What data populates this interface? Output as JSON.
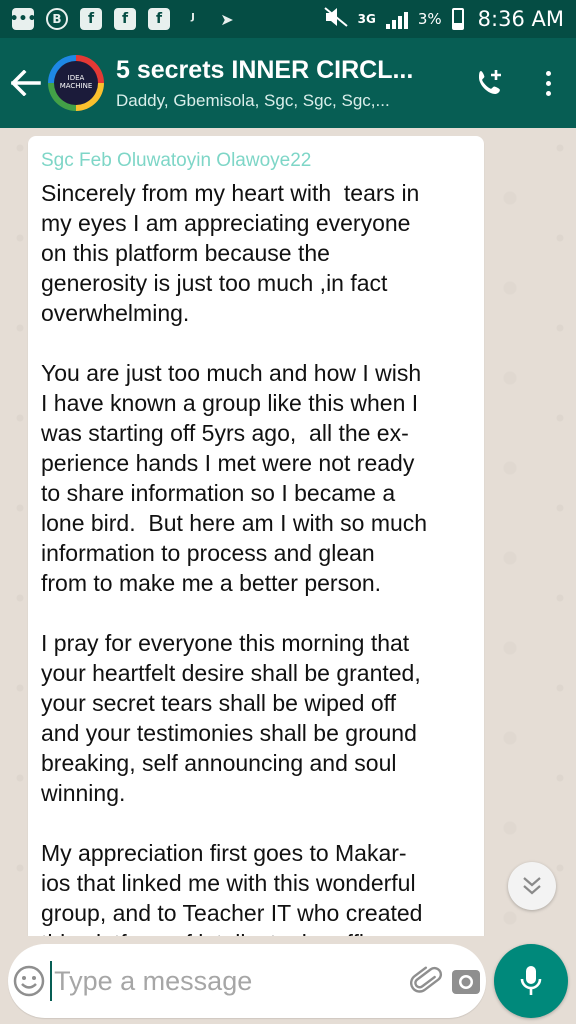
{
  "status_bar": {
    "icons": [
      "chat-bubble-icon",
      "b-circle-icon",
      "facebook-icon",
      "facebook-icon",
      "facebook-icon",
      "jiji-icon",
      "telegram-icon",
      "mute-icon",
      "network-3g-icon",
      "signal-icon",
      "battery-icon"
    ],
    "network": "3G",
    "battery": "3%",
    "time": "8:36 AM"
  },
  "header": {
    "avatar_text_top": "IDEA",
    "avatar_text_bottom": "MACHINE",
    "title": "5 secrets INNER CIRCL...",
    "subtitle": "Daddy, Gbemisola, Sgc, Sgc, Sgc,..."
  },
  "message": {
    "sender": "Sgc Feb Oluwatoyin Olawoye22",
    "text": "Sincerely from my heart with  tears in\nmy eyes I am appreciating everyone\non this platform because the\ngenerosity is just too much ,in fact\noverwhelming.\n\nYou are just too much and how I wish\nI have known a group like this when I\nwas starting off 5yrs ago,  all the ex-\nperience hands I met were not ready\nto share information so I became a\nlone bird.  But here am I with so much\ninformation to process and glean\nfrom to make me a better person.\n\nI pray for everyone this morning that\nyour heartfelt desire shall be granted,\nyour secret tears shall be wiped off\nand your testimonies shall be ground\nbreaking, self announcing and soul\nwinning.\n\nMy appreciation first goes to Makar-\nios that linked me with this wonderful\ngroup, and to Teacher IT who created\nthis platform of intellectual proffle"
  },
  "compose": {
    "placeholder": "Type a message"
  },
  "colors": {
    "status_bar": "#054d44",
    "app_bar": "#075e54",
    "sender_name": "#7ed6c7",
    "mic_button": "#00897b",
    "chat_background": "#e5ddd5"
  }
}
